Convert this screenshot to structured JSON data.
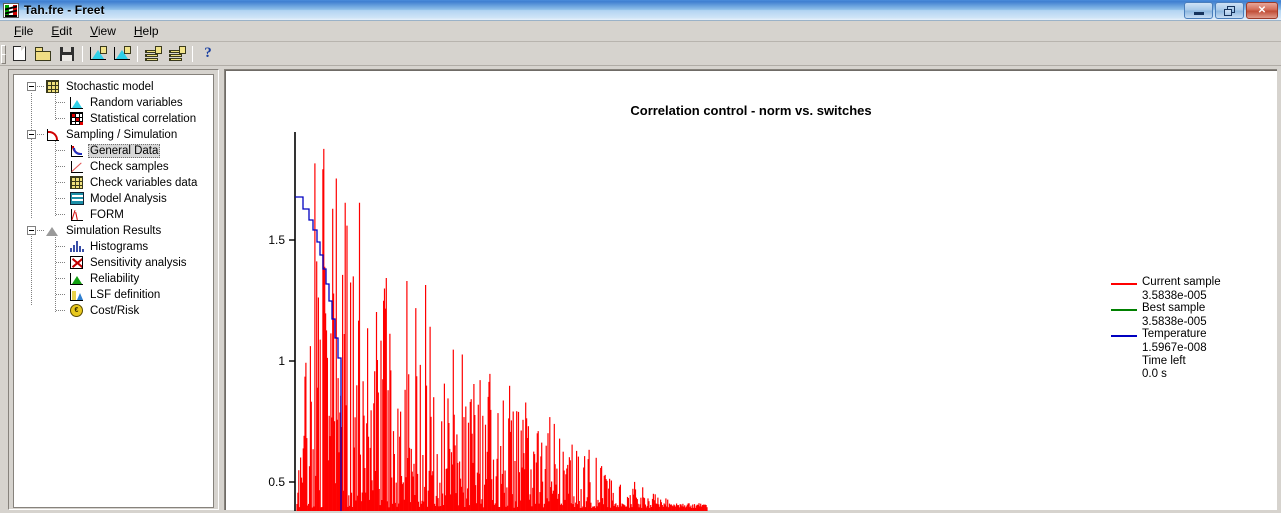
{
  "window": {
    "title": "Tah.fre - Freet",
    "icon": "app-icon",
    "buttons": {
      "minimize": "–",
      "restore": "❐",
      "close": "✕"
    }
  },
  "menu": {
    "items": [
      {
        "label": "File",
        "accel": "F"
      },
      {
        "label": "Edit",
        "accel": "E"
      },
      {
        "label": "View",
        "accel": "V"
      },
      {
        "label": "Help",
        "accel": "H"
      }
    ]
  },
  "toolbar": {
    "buttons": [
      {
        "name": "new-icon",
        "title": "New"
      },
      {
        "name": "open-icon",
        "title": "Open"
      },
      {
        "name": "save-icon",
        "title": "Save"
      },
      {
        "name": "distribution-add-icon",
        "title": "Add random variable"
      },
      {
        "name": "distribution-edit-icon",
        "title": "Edit random variable"
      },
      {
        "name": "grid-add-icon",
        "title": "Add data grid"
      },
      {
        "name": "grid-edit-icon",
        "title": "Edit data grid"
      },
      {
        "name": "help-icon",
        "title": "Help"
      }
    ],
    "help_glyph": "?"
  },
  "tree": {
    "nodes": [
      {
        "label": "Stochastic model",
        "level": 0,
        "icon": "grid-icon",
        "expanded": true,
        "selected": false
      },
      {
        "label": "Random variables",
        "level": 1,
        "icon": "distribution-icon",
        "expanded": null,
        "selected": false
      },
      {
        "label": "Statistical correlation",
        "level": 1,
        "icon": "correlation-icon",
        "expanded": null,
        "selected": false
      },
      {
        "label": "Sampling / Simulation",
        "level": 0,
        "icon": "curve-icon",
        "expanded": true,
        "selected": false
      },
      {
        "label": "General Data",
        "level": 1,
        "icon": "general-data-icon",
        "expanded": null,
        "selected": true
      },
      {
        "label": "Check samples",
        "level": 1,
        "icon": "scatter-icon",
        "expanded": null,
        "selected": false
      },
      {
        "label": "Check variables data",
        "level": 1,
        "icon": "grid-icon",
        "expanded": null,
        "selected": false
      },
      {
        "label": "Model Analysis",
        "level": 1,
        "icon": "table-icon",
        "expanded": null,
        "selected": false
      },
      {
        "label": "FORM",
        "level": 1,
        "icon": "form-icon",
        "expanded": null,
        "selected": false
      },
      {
        "label": "Simulation Results",
        "level": 0,
        "icon": "results-icon",
        "expanded": true,
        "selected": false
      },
      {
        "label": "Histograms",
        "level": 1,
        "icon": "histogram-icon",
        "expanded": null,
        "selected": false
      },
      {
        "label": "Sensitivity analysis",
        "level": 1,
        "icon": "sensitivity-icon",
        "expanded": null,
        "selected": false
      },
      {
        "label": "Reliability",
        "level": 1,
        "icon": "reliability-icon",
        "expanded": null,
        "selected": false
      },
      {
        "label": "LSF definition",
        "level": 1,
        "icon": "lsf-icon",
        "expanded": null,
        "selected": false
      },
      {
        "label": "Cost/Risk",
        "level": 1,
        "icon": "cost-risk-icon",
        "expanded": null,
        "selected": false
      }
    ]
  },
  "chart_data": {
    "type": "line",
    "title": "Correlation control - norm vs. switches",
    "xlabel": "",
    "ylabel": "",
    "grid": false,
    "legend_position": "right",
    "yticks": [
      "1.5",
      "1",
      "0.5"
    ],
    "ytick_values": [
      1.5,
      1.0,
      0.5
    ],
    "ylim": [
      0,
      1.9
    ],
    "xlim": [
      0,
      1000
    ],
    "series": [
      {
        "name": "Current sample",
        "color": "#ff0000",
        "value_label": "3.5838e-005",
        "description": "Dense oscillating norm trace decaying from ~1.85 at start to near 0 by the right end of the drawn data"
      },
      {
        "name": "Best sample",
        "color": "#008000",
        "value_label": "3.5838e-005",
        "description": "Monotonically decreasing best-so-far norm, overlapped by the red trace"
      },
      {
        "name": "Temperature",
        "color": "#0000c0",
        "value_label": "1.5967e-008",
        "description": "Descending staircase from ~1.35 to 0 over the first third of the axis"
      }
    ],
    "annotations": [
      {
        "label": "Time left",
        "value": "0.0 s"
      }
    ]
  },
  "legend": {
    "entries": [
      {
        "label": "Current sample",
        "value": "3.5838e-005",
        "color": "#ff0000"
      },
      {
        "label": "Best sample",
        "value": "3.5838e-005",
        "color": "#008000"
      },
      {
        "label": "Temperature",
        "value": "1.5967e-008",
        "color": "#0000c0"
      }
    ],
    "time_left_label": "Time left",
    "time_left_value": "0.0 s"
  }
}
